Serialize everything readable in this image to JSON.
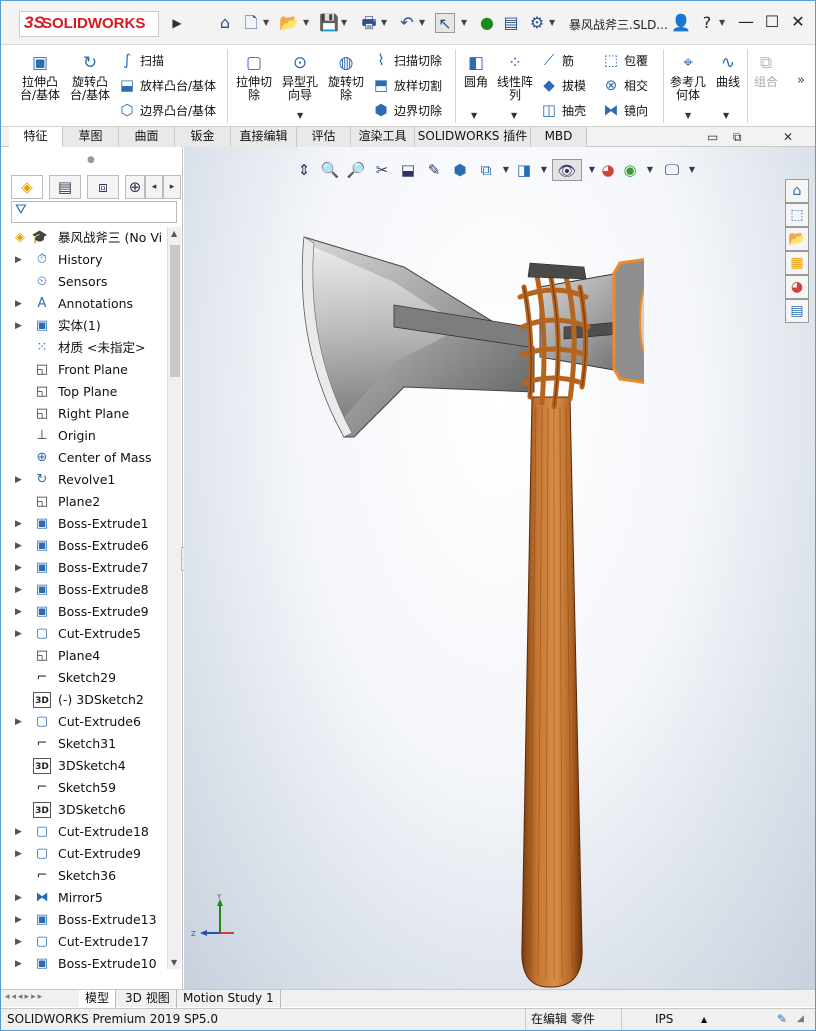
{
  "titlebar": {
    "logo_text": "SOLIDWORKS",
    "logo_mark": "3S",
    "doc_title": "暴风战斧三.SLD...",
    "icons": [
      "home-icon",
      "new-doc-icon",
      "open-icon",
      "save-icon",
      "print-icon",
      "undo-icon",
      "select-icon",
      "traffic-light-icon",
      "file-props-icon",
      "gear-icon"
    ],
    "window_buttons": {
      "minimize": "—",
      "restore": "☐",
      "close": "✕"
    }
  },
  "commands": {
    "extrude_boss": "拉伸凸\n台/基体",
    "revolve_boss": "旋转凸\n台/基体",
    "sweep": "扫描",
    "loft": "放样凸台/基体",
    "boundary_boss": "边界凸台/基体",
    "extrude_cut": "拉伸切\n除",
    "hole_wizard": "异型孔\n向导",
    "revolve_cut": "旋转切\n除",
    "swept_cut": "扫描切除",
    "lofted_cut": "放样切割",
    "boundary_cut": "边界切除",
    "fillet": "圆角",
    "linear_pattern": "线性阵\n列",
    "rib": "筋",
    "draft": "拔模",
    "shell": "抽壳",
    "wrap": "包覆",
    "intersect": "相交",
    "mirror": "镜向",
    "ref_geometry": "参考几\n何体",
    "curves": "曲线",
    "combine": "组合"
  },
  "tabs": [
    "特征",
    "草图",
    "曲面",
    "钣金",
    "直接编辑",
    "评估",
    "渲染工具",
    "SOLIDWORKS 插件",
    "MBD"
  ],
  "tree": {
    "root": "暴风战斧三  (No Vi",
    "items": [
      {
        "label": "History",
        "icon": "history-icon",
        "expand": true
      },
      {
        "label": "Sensors",
        "icon": "sensor-icon",
        "expand": false
      },
      {
        "label": "Annotations",
        "icon": "annotation-icon",
        "expand": true
      },
      {
        "label": "实体(1)",
        "icon": "solid-bodies-icon",
        "expand": true
      },
      {
        "label": "材质 <未指定>",
        "icon": "material-icon",
        "expand": false
      },
      {
        "label": "Front Plane",
        "icon": "plane-icon",
        "expand": false
      },
      {
        "label": "Top Plane",
        "icon": "plane-icon",
        "expand": false
      },
      {
        "label": "Right Plane",
        "icon": "plane-icon",
        "expand": false
      },
      {
        "label": "Origin",
        "icon": "origin-icon",
        "expand": false
      },
      {
        "label": "Center of Mass",
        "icon": "center-of-mass-icon",
        "expand": false
      },
      {
        "label": "Revolve1",
        "icon": "revolve-icon",
        "expand": true
      },
      {
        "label": "Plane2",
        "icon": "plane-icon",
        "expand": false
      },
      {
        "label": "Boss-Extrude1",
        "icon": "boss-extrude-icon",
        "expand": true
      },
      {
        "label": "Boss-Extrude6",
        "icon": "boss-extrude-icon",
        "expand": true
      },
      {
        "label": "Boss-Extrude7",
        "icon": "boss-extrude-icon",
        "expand": true
      },
      {
        "label": "Boss-Extrude8",
        "icon": "boss-extrude-icon",
        "expand": true
      },
      {
        "label": "Boss-Extrude9",
        "icon": "boss-extrude-icon",
        "expand": true
      },
      {
        "label": "Cut-Extrude5",
        "icon": "cut-extrude-icon",
        "expand": true
      },
      {
        "label": "Plane4",
        "icon": "plane-icon",
        "expand": false
      },
      {
        "label": "Sketch29",
        "icon": "sketch-icon",
        "expand": false
      },
      {
        "label": "(-) 3DSketch2",
        "icon": "3d-sketch-icon",
        "expand": false
      },
      {
        "label": "Cut-Extrude6",
        "icon": "cut-extrude-icon",
        "expand": true
      },
      {
        "label": "Sketch31",
        "icon": "sketch-icon",
        "expand": false
      },
      {
        "label": "3DSketch4",
        "icon": "3d-sketch-icon",
        "expand": false
      },
      {
        "label": "Sketch59",
        "icon": "sketch-icon",
        "expand": false
      },
      {
        "label": "3DSketch6",
        "icon": "3d-sketch-icon",
        "expand": false
      },
      {
        "label": "Cut-Extrude18",
        "icon": "cut-extrude-icon",
        "expand": true
      },
      {
        "label": "Cut-Extrude9",
        "icon": "cut-extrude-icon",
        "expand": true
      },
      {
        "label": "Sketch36",
        "icon": "sketch-icon",
        "expand": false
      },
      {
        "label": "Mirror5",
        "icon": "mirror-icon",
        "expand": true
      },
      {
        "label": "Boss-Extrude13",
        "icon": "boss-extrude-icon",
        "expand": true
      },
      {
        "label": "Cut-Extrude17",
        "icon": "cut-extrude-icon",
        "expand": true
      },
      {
        "label": "Boss-Extrude10",
        "icon": "boss-extrude-icon",
        "expand": true
      }
    ]
  },
  "triad": {
    "x": "X",
    "y": "Y",
    "z": "Z"
  },
  "bottom_tabs": [
    "模型",
    "3D 视图",
    "Motion Study 1"
  ],
  "status": {
    "product": "SOLIDWORKS Premium 2019 SP5.0",
    "mode": "在编辑 零件",
    "units": "IPS"
  },
  "colors": {
    "accent": "#2a6db3",
    "brand_red": "#d71920",
    "highlight_orange": "#f08a24",
    "handle_brown": "#b86a2e"
  }
}
